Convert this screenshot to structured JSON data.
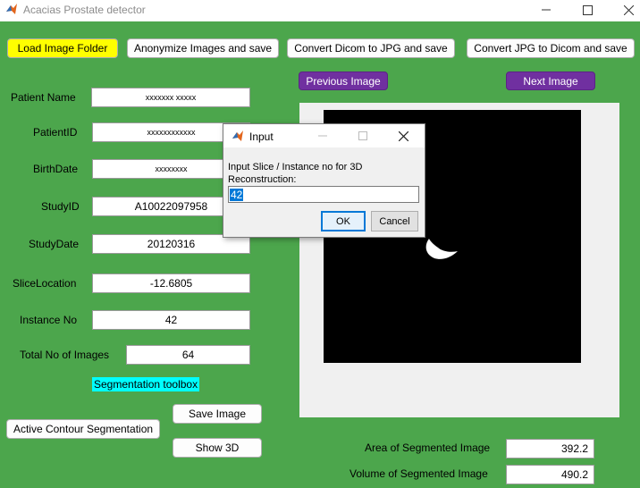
{
  "window": {
    "title": "Acacias Prostate detector",
    "icon": "matlab-icon"
  },
  "toolbar": {
    "load_folder": "Load Image Folder",
    "anonymize": "Anonymize Images and save",
    "dicom_to_jpg": "Convert Dicom to JPG and save",
    "jpg_to_dicom": "Convert JPG to Dicom and save"
  },
  "nav": {
    "previous": "Previous Image",
    "next": "Next Image"
  },
  "fields": {
    "patient_name_label": "Patient Name",
    "patient_name_value": "xxxxxxx xxxxx",
    "patient_id_label": "PatientID",
    "patient_id_value": "xxxxxxxxxxxx",
    "birthdate_label": "BirthDate",
    "birthdate_value": "xxxxxxxx",
    "study_id_label": "StudyID",
    "study_id_value": "A10022097958",
    "study_date_label": "StudyDate",
    "study_date_value": "20120316",
    "slice_location_label": "SliceLocation",
    "slice_location_value": "-12.6805",
    "instance_no_label": "Instance No",
    "instance_no_value": "42",
    "total_images_label": "Total No of Images",
    "total_images_value": "64"
  },
  "segmentation": {
    "toolbox_label": "Segmentation toolbox",
    "active_contour": "Active Contour Segmentation",
    "save_image": "Save Image",
    "show_3d": "Show 3D"
  },
  "results": {
    "area_label": "Area of Segmented Image",
    "area_value": "392.2",
    "volume_label": "Volume of Segmented Image",
    "volume_value": "490.2"
  },
  "dialog": {
    "title": "Input",
    "prompt": "Input Slice / Instance no for 3D Reconstruction:",
    "value": "42",
    "ok": "OK",
    "cancel": "Cancel"
  },
  "colors": {
    "background": "#4ca64c",
    "load_button": "#ffff00",
    "nav_button": "#7030a0",
    "toolbox_label": "#00ffff"
  }
}
